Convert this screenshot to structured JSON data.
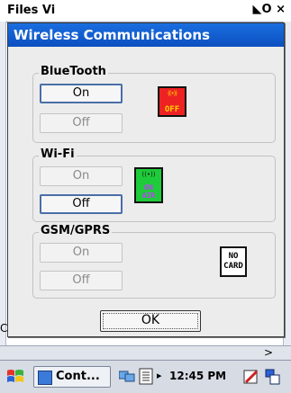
{
  "background_window": {
    "title": "Files Vi",
    "right_glyphs": "◣O ×",
    "edge_letter": "C"
  },
  "dialog": {
    "title": "Wireless Communications",
    "bluetooth": {
      "label": "BlueTooth",
      "on_label": "On",
      "off_label": "Off",
      "status_icon": {
        "name": "radio-off-icon",
        "wave_text": "((•))",
        "text": "OFF",
        "color": "#ee2222"
      }
    },
    "wifi": {
      "label": "Wi-Fi",
      "on_label": "On",
      "off_label": "Off",
      "status_icon": {
        "name": "on-air-icon",
        "wave_text": "((•))",
        "line1": "ON",
        "line2": "AIR",
        "color": "#1ecb3a"
      }
    },
    "gsm": {
      "label": "GSM/GPRS",
      "on_label": "On",
      "off_label": "Off",
      "status_icon": {
        "name": "no-card-icon",
        "line1": "NO",
        "line2": "CARD"
      }
    },
    "ok_label": "OK"
  },
  "taskbar": {
    "task_label": "Cont...",
    "clock": "12:45 PM",
    "tray_arrow": "▸"
  },
  "colors": {
    "title_bar": "#0b4fc0",
    "dialog_bg": "#ececec",
    "taskbar_bg": "#d6dbe4"
  }
}
